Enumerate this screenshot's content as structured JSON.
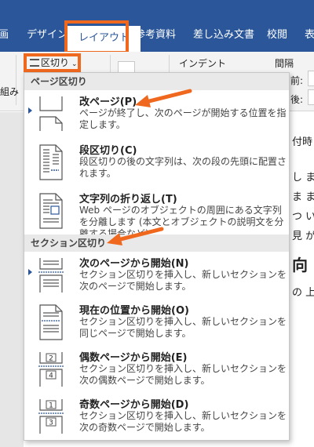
{
  "tabs": [
    {
      "label": "画"
    },
    {
      "label": "デザイン"
    },
    {
      "label": "レイアウト",
      "active": true
    },
    {
      "label": "参考資料"
    },
    {
      "label": "差し込み文書"
    },
    {
      "label": "校閲"
    },
    {
      "label": "表"
    }
  ],
  "ribbon": {
    "breaks_label": "区切り",
    "indent_label": "インデント",
    "spacing_label": "間隔",
    "before_label": "前:",
    "after_label": "後:",
    "left_partial": "組み"
  },
  "dropdown": {
    "sections": [
      {
        "header": "ページ区切り",
        "items": [
          {
            "title": "改ページ(P)",
            "desc": "ページが終了し、次のページが開始する位置を指定します。",
            "selected": true
          },
          {
            "title": "段区切り(C)",
            "desc": "段区切りの後の文字列は、次の段の先頭に配置されます。"
          },
          {
            "title": "文字列の折り返し(T)",
            "desc": "Web ページのオブジェクトの周囲にある文字列を分離します (本文とオブジェクトの説明文を分離する場合など)。"
          }
        ]
      },
      {
        "header": "セクション区切り",
        "items": [
          {
            "title": "次のページから開始(N)",
            "desc": "セクション区切りを挿入し、新しいセクションを次のページで開始します。",
            "selected": true
          },
          {
            "title": "現在の位置から開始(O)",
            "desc": "セクション区切りを挿入し、新しいセクションを同じページで開始します。"
          },
          {
            "title": "偶数ページから開始(E)",
            "desc": "セクション区切りを挿入し、新しいセクションを次の偶数ページで開始します。"
          },
          {
            "title": "奇数ページから開始(D)",
            "desc": "セクション区切りを挿入し、新しいセクションを次の奇数ページで開始します。"
          }
        ]
      }
    ]
  },
  "doc_lines": [
    "付時",
    "し ま",
    "ま ま",
    "つ い",
    "見 が",
    "向",
    "の 上"
  ],
  "colors": {
    "accent": "#2b579a",
    "highlight": "#f0681e"
  }
}
